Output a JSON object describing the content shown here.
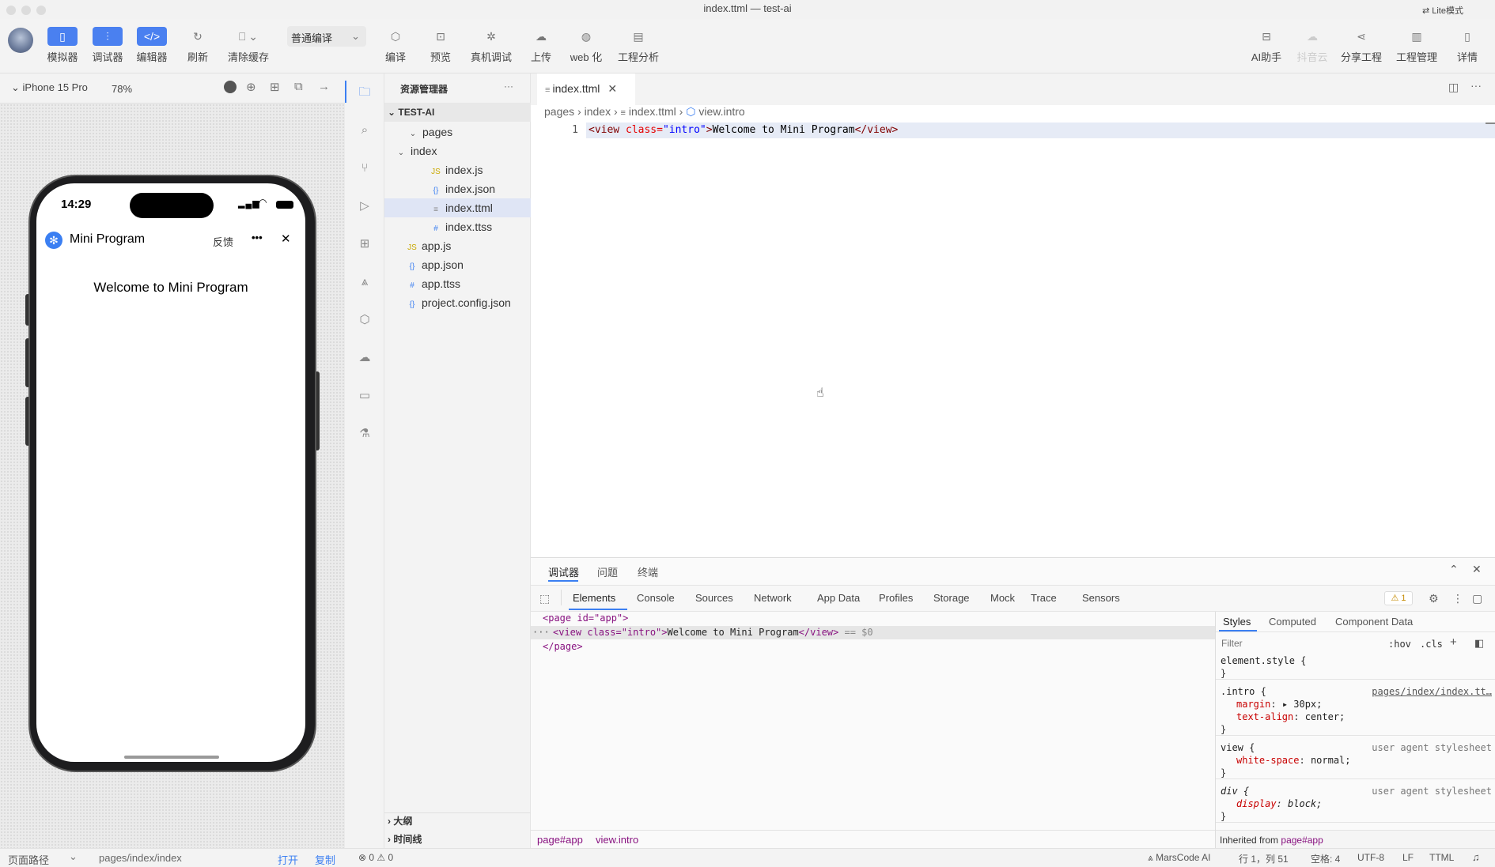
{
  "window": {
    "title": "index.ttml — test-ai",
    "mode_label": "Lite模式"
  },
  "toolbar": {
    "simulator": "模拟器",
    "debugger": "调试器",
    "editor": "编辑器",
    "refresh": "刷新",
    "clear_cache": "清除缓存",
    "compile_mode": "普通编译",
    "compile": "编译",
    "preview": "预览",
    "remote_debug": "真机调试",
    "upload": "上传",
    "web": "web 化",
    "analysis": "工程分析",
    "ai": "AI助手",
    "cloud": "抖音云",
    "share": "分享工程",
    "manage": "工程管理",
    "details": "详情"
  },
  "simulator": {
    "device": "iPhone 15 Pro",
    "zoom": "78%",
    "time": "14:29",
    "app_title": "Mini Program",
    "feedback": "反馈",
    "more": "•••",
    "close": "✕",
    "content_text": "Welcome to Mini Program"
  },
  "explorer": {
    "title": "资源管理器",
    "more": "···",
    "project": "TEST-AI",
    "files": [
      {
        "label": "pages",
        "icon": "⌄"
      },
      {
        "label": "index",
        "icon": "⌄"
      },
      {
        "label": "index.js",
        "icon": "JS"
      },
      {
        "label": "index.json",
        "icon": "{}"
      },
      {
        "label": "index.ttml",
        "icon": "≡"
      },
      {
        "label": "index.ttss",
        "icon": "#"
      },
      {
        "label": "app.js",
        "icon": "JS"
      },
      {
        "label": "app.json",
        "icon": "{}"
      },
      {
        "label": "app.ttss",
        "icon": "#"
      },
      {
        "label": "project.config.json",
        "icon": "{}"
      }
    ],
    "outline": "大纲",
    "timeline": "时间线"
  },
  "editor": {
    "tab": "index.ttml",
    "breadcrumb": [
      "pages",
      "index",
      "index.ttml",
      "view.intro"
    ],
    "line_number": "1",
    "code": {
      "open_tag": "<view ",
      "attr": "class=",
      "val": "\"intro\"",
      "gt": ">",
      "text": "Welcome to Mini Program",
      "close_tag": "</view>"
    }
  },
  "devtools": {
    "tabs": [
      "调试器",
      "问题",
      "终端"
    ],
    "panels": [
      "Elements",
      "Console",
      "Sources",
      "Network",
      "App Data",
      "Profiles",
      "Storage",
      "Mock",
      "Trace",
      "Sensors"
    ],
    "warning": "⚠ 1",
    "dom": {
      "line1": "<page id=\"app\">",
      "line2_open": "<view class=\"intro\">",
      "line2_text": "Welcome to Mini Program",
      "line2_close": "</view>",
      "line2_eq": " == $0",
      "line3": "</page>"
    },
    "breadcrumb": [
      "page#app",
      "view.intro"
    ],
    "styles_tabs": [
      "Styles",
      "Computed",
      "Component Data"
    ],
    "filter_placeholder": "Filter",
    "hov": ":hov",
    "cls": ".cls",
    "rules": [
      {
        "selector": "element.style {",
        "source": "",
        "props": [],
        "close": "}"
      },
      {
        "selector": ".intro {",
        "source": "pages/index/index.tt…",
        "props": [
          {
            "name": "margin",
            "value": "▸ 30px;"
          },
          {
            "name": "text-align",
            "value": "center;"
          }
        ],
        "close": "}"
      },
      {
        "selector": "view {",
        "source": "user agent stylesheet",
        "props": [
          {
            "name": "white-space",
            "value": "normal;"
          }
        ],
        "close": "}"
      },
      {
        "selector": "div {",
        "source": "user agent stylesheet",
        "props": [
          {
            "name": "display",
            "value": "block;"
          }
        ],
        "close": "}"
      }
    ],
    "inherited": "Inherited from",
    "inherited_from": "page#app"
  },
  "statusbar": {
    "page_path_label": "页面路径",
    "page_path": "pages/index/index",
    "open": "打开",
    "copy": "复制",
    "problems": "⊗ 0 ⚠ 0",
    "marscode": "MarsCode AI",
    "position": "行 1，列 51",
    "spaces": "空格: 4",
    "encoding": "UTF-8",
    "eol": "LF",
    "lang": "TTML"
  }
}
